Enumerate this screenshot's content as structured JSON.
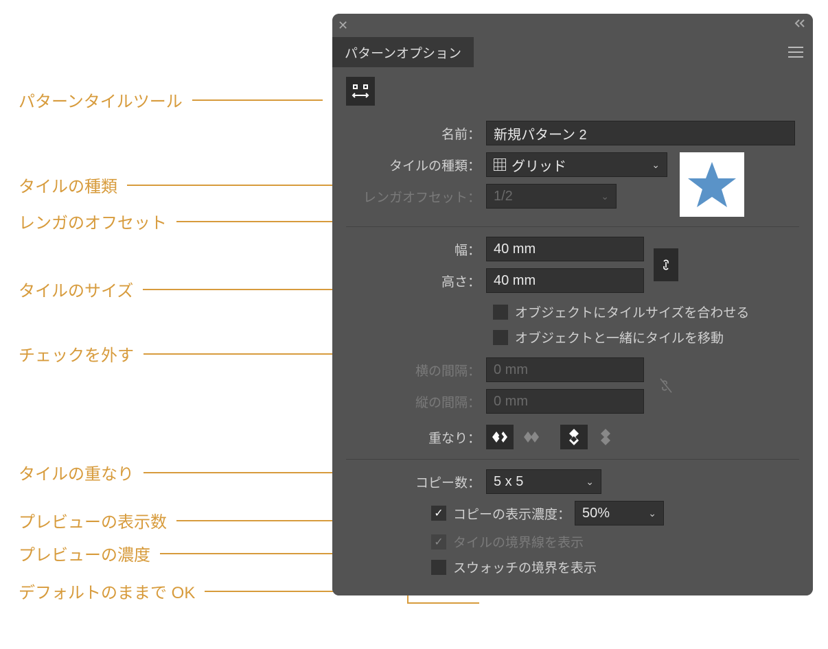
{
  "annotations": {
    "tile_tool": "パターンタイルツール",
    "tile_type": "タイルの種類",
    "brick_offset": "レンガのオフセット",
    "tile_size": "タイルのサイズ",
    "uncheck": "チェックを外す",
    "overlap": "タイルの重なり",
    "preview_count": "プレビューの表示数",
    "preview_dim": "プレビューの濃度",
    "default_ok": "デフォルトのままで OK"
  },
  "panel": {
    "tab_title": "パターンオプション",
    "name_label": "名前：",
    "name_value": "新規パターン 2",
    "tile_type_label": "タイルの種類：",
    "tile_type_value": "グリッド",
    "brick_offset_label": "レンガオフセット：",
    "brick_offset_value": "1/2",
    "width_label": "幅：",
    "width_value": "40 mm",
    "height_label": "高さ：",
    "height_value": "40 mm",
    "fit_tile_label": "オブジェクトにタイルサイズを合わせる",
    "move_tile_label": "オブジェクトと一緒にタイルを移動",
    "hspacing_label": "横の間隔：",
    "hspacing_value": "0 mm",
    "vspacing_label": "縦の間隔：",
    "vspacing_value": "0 mm",
    "overlap_label": "重なり：",
    "copies_label": "コピー数：",
    "copies_value": "5 x 5",
    "dim_copies_label": "コピーの表示濃度：",
    "dim_copies_value": "50%",
    "show_tile_edge_label": "タイルの境界線を表示",
    "show_swatch_edge_label": "スウォッチの境界を表示"
  }
}
